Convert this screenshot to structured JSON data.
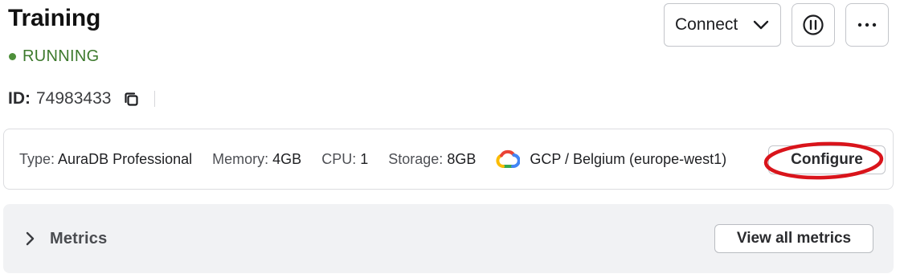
{
  "header": {
    "title": "Training",
    "status": "RUNNING",
    "status_color": "#4d8f3a",
    "id_label": "ID:",
    "id_value": "74983433"
  },
  "actions": {
    "connect_label": "Connect",
    "pause_icon": "pause-circle-icon",
    "more_icon": "more-horizontal-icon"
  },
  "instance": {
    "type_label": "Type:",
    "type_value": "AuraDB Professional",
    "memory_label": "Memory:",
    "memory_value": "4GB",
    "cpu_label": "CPU:",
    "cpu_value": "1",
    "storage_label": "Storage:",
    "storage_value": "8GB",
    "cloud_icon": "google-cloud-icon",
    "region": "GCP / Belgium (europe-west1)",
    "configure_label": "Configure",
    "highlight_color": "#d9141b"
  },
  "metrics": {
    "label": "Metrics",
    "view_all_label": "View all metrics"
  }
}
